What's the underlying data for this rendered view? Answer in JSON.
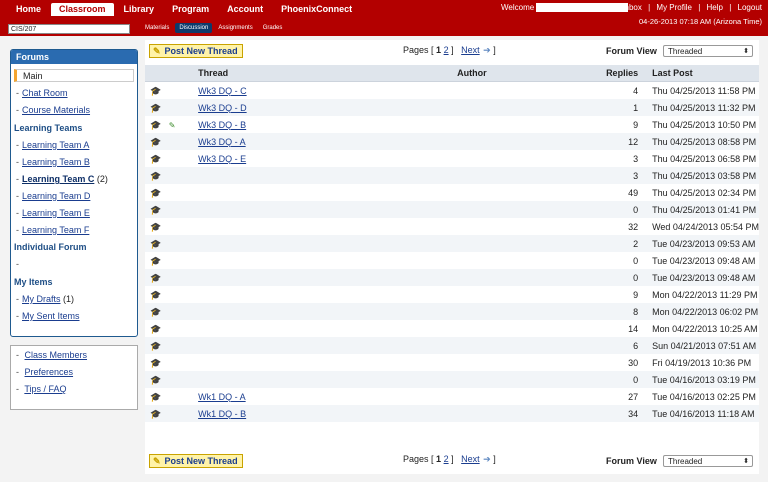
{
  "topnav": {
    "tabs": [
      "Home",
      "Classroom",
      "Library",
      "Program",
      "Account",
      "PhoenixConnect"
    ],
    "active": "Classroom"
  },
  "welcome_label": "Welcome",
  "toplinks": {
    "inbox": "Inbox",
    "profile": "My Profile",
    "help": "Help",
    "logout": "Logout"
  },
  "datetime": "04-26-2013 07:18 AM (Arizona Time)",
  "course_select": "CIS/207",
  "subnav": [
    "Materials",
    "Discussion",
    "Assignments",
    "Grades"
  ],
  "sidebar": {
    "title": "Forums",
    "main": "Main",
    "links": [
      "Chat Room",
      "Course Materials"
    ],
    "learning_teams_head": "Learning Teams",
    "teams": [
      "Learning Team A",
      "Learning Team B",
      "Learning Team C",
      "Learning Team D",
      "Learning Team E",
      "Learning Team F"
    ],
    "team_c_count": "(2)",
    "individual_head": "Individual Forum",
    "my_items_head": "My Items",
    "my_drafts": "My Drafts",
    "my_drafts_count": "(1)",
    "my_sent": "My Sent Items",
    "tools": [
      "Class Members",
      "Preferences",
      "Tips / FAQ"
    ]
  },
  "toolbar": {
    "new_thread": "Post New Thread",
    "pages_label": "Pages [",
    "page1": "1",
    "page2": "2",
    "close_bracket": "]",
    "next": "Next",
    "forum_view_label": "Forum View",
    "forum_view_value": "Threaded"
  },
  "table": {
    "headers": {
      "thread": "Thread",
      "author": "Author",
      "replies": "Replies",
      "last": "Last Post"
    },
    "rows": [
      {
        "thread": "Wk3 DQ - C",
        "replies": "4",
        "last": "Thu 04/25/2013 11:58 PM",
        "flag": false
      },
      {
        "thread": "Wk3 DQ - D",
        "replies": "1",
        "last": "Thu 04/25/2013 11:32 PM",
        "flag": false
      },
      {
        "thread": "Wk3 DQ - B",
        "replies": "9",
        "last": "Thu 04/25/2013 10:50 PM",
        "flag": true
      },
      {
        "thread": "Wk3 DQ - A",
        "replies": "12",
        "last": "Thu 04/25/2013 08:58 PM",
        "flag": false
      },
      {
        "thread": "Wk3 DQ - E",
        "replies": "3",
        "last": "Thu 04/25/2013 06:58 PM",
        "flag": false
      },
      {
        "thread": "",
        "replies": "3",
        "last": "Thu 04/25/2013 03:58 PM",
        "flag": false
      },
      {
        "thread": "",
        "replies": "49",
        "last": "Thu 04/25/2013 02:34 PM",
        "flag": false
      },
      {
        "thread": "",
        "replies": "0",
        "last": "Thu 04/25/2013 01:41 PM",
        "flag": false
      },
      {
        "thread": "",
        "replies": "32",
        "last": "Wed 04/24/2013 05:54 PM",
        "flag": false
      },
      {
        "thread": "",
        "replies": "2",
        "last": "Tue 04/23/2013 09:53 AM",
        "flag": false
      },
      {
        "thread": "",
        "replies": "0",
        "last": "Tue 04/23/2013 09:48 AM",
        "flag": false
      },
      {
        "thread": "",
        "replies": "0",
        "last": "Tue 04/23/2013 09:48 AM",
        "flag": false
      },
      {
        "thread": "",
        "replies": "9",
        "last": "Mon 04/22/2013 11:29 PM",
        "flag": false
      },
      {
        "thread": "",
        "replies": "8",
        "last": "Mon 04/22/2013 06:02 PM",
        "flag": false
      },
      {
        "thread": "",
        "replies": "14",
        "last": "Mon 04/22/2013 10:25 AM",
        "flag": false
      },
      {
        "thread": "",
        "replies": "6",
        "last": "Sun 04/21/2013 07:51 AM",
        "flag": false
      },
      {
        "thread": "",
        "replies": "30",
        "last": "Fri 04/19/2013 10:36 PM",
        "flag": false
      },
      {
        "thread": "",
        "replies": "0",
        "last": "Tue 04/16/2013 03:19 PM",
        "flag": false
      },
      {
        "thread": "Wk1 DQ - A",
        "replies": "27",
        "last": "Tue 04/16/2013 02:25 PM",
        "flag": false
      },
      {
        "thread": "Wk1 DQ - B",
        "replies": "34",
        "last": "Tue 04/16/2013 11:18 AM",
        "flag": false
      }
    ]
  }
}
